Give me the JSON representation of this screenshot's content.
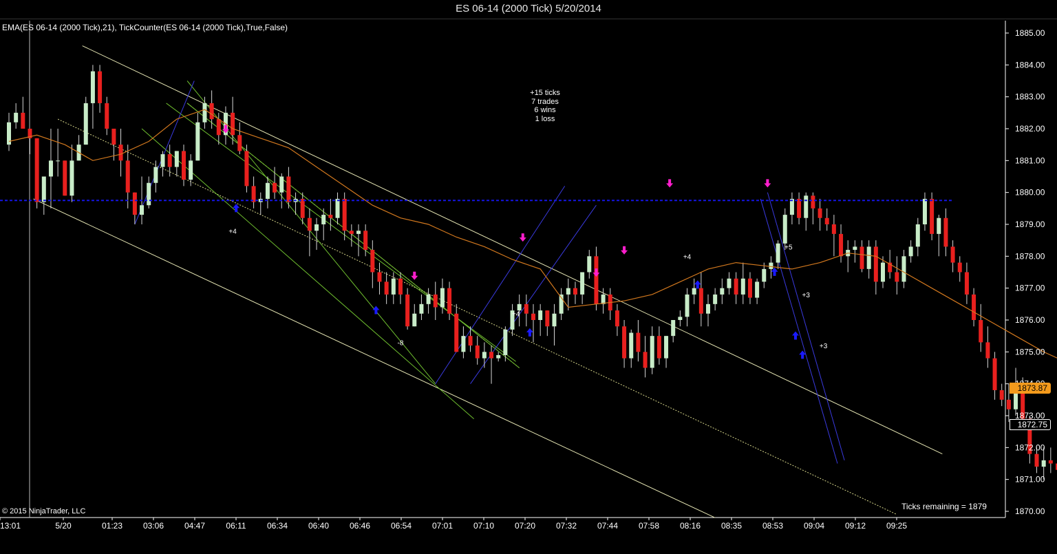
{
  "window": {
    "title": "ES 06-14 (2000 Tick)  5/20/2014"
  },
  "indicator_label": "EMA(ES 06-14 (2000 Tick),21),  TickCounter(ES 06-14 (2000 Tick),True,False)",
  "copyright": "© 2015 NinjaTrader, LLC",
  "ticks_remaining": "Ticks remaining = 1879",
  "stats": [
    "+15 ticks",
    "7 trades",
    "6 wins",
    "1 loss"
  ],
  "price_tags": {
    "ema": "1873.87",
    "last": "1872.75"
  },
  "colors": {
    "up_candle": "#c8ecc8",
    "down_candle": "#e8201e",
    "wick": "#d8d8d8",
    "ema": "#d2781e",
    "support": "#1414e6",
    "channel": "#e6e6b4",
    "fan_green": "#6fbf2f",
    "fan_blue": "#3a3ae0",
    "buy_arrow": "#1a1aff",
    "sell_arrow": "#ff1ecd",
    "axis_text": "#ffffff"
  },
  "chart_data": {
    "type": "candlestick",
    "y_axis": {
      "min": 1870,
      "max": 1885,
      "ticks": [
        "1885.00",
        "1884.00",
        "1883.00",
        "1882.00",
        "1881.00",
        "1880.00",
        "1879.00",
        "1878.00",
        "1877.00",
        "1876.00",
        "1875.00",
        "1874.00",
        "1873.00",
        "1872.00",
        "1871.00",
        "1870.00"
      ]
    },
    "x_labels": [
      "13:01",
      "5/20",
      "01:23",
      "03:06",
      "04:47",
      "06:11",
      "06:34",
      "06:40",
      "06:46",
      "06:54",
      "07:01",
      "07:10",
      "07:20",
      "07:32",
      "07:44",
      "07:58",
      "08:16",
      "08:35",
      "08:53",
      "09:04",
      "09:12",
      "09:25"
    ],
    "candles": [
      [
        1881.5,
        1882.5,
        1881.3,
        1882.2
      ],
      [
        1882.2,
        1882.8,
        1882.0,
        1882.5
      ],
      [
        1882.5,
        1883.0,
        1882.0,
        1882.0
      ],
      [
        1882.0,
        1882.0,
        1881.2,
        1881.7
      ],
      [
        1881.7,
        1881.7,
        1879.5,
        1879.7
      ],
      [
        1879.7,
        1880.5,
        1879.3,
        1880.5
      ],
      [
        1880.5,
        1882.0,
        1879.5,
        1881.0
      ],
      [
        1881.0,
        1882.0,
        1880.5,
        1881.0
      ],
      [
        1881.0,
        1881.0,
        1879.9,
        1879.9
      ],
      [
        1879.9,
        1881.5,
        1879.7,
        1881.0
      ],
      [
        1881.0,
        1881.8,
        1881.0,
        1881.5
      ],
      [
        1881.5,
        1883.0,
        1881.5,
        1882.8
      ],
      [
        1882.8,
        1884.0,
        1882.0,
        1883.8
      ],
      [
        1883.8,
        1884.0,
        1882.5,
        1882.8
      ],
      [
        1882.8,
        1883.0,
        1881.8,
        1882.0
      ],
      [
        1882.0,
        1882.0,
        1881.0,
        1881.5
      ],
      [
        1881.5,
        1882.0,
        1880.5,
        1881.0
      ],
      [
        1881.0,
        1881.5,
        1879.5,
        1880.0
      ],
      [
        1880.0,
        1880.0,
        1879.0,
        1879.3
      ],
      [
        1879.3,
        1880.5,
        1879.0,
        1879.6
      ],
      [
        1879.6,
        1880.5,
        1879.5,
        1880.3
      ],
      [
        1880.3,
        1881.0,
        1880.0,
        1880.8
      ],
      [
        1880.8,
        1881.3,
        1880.5,
        1881.2
      ],
      [
        1881.2,
        1881.5,
        1880.5,
        1880.8
      ],
      [
        1880.8,
        1881.3,
        1880.5,
        1881.3
      ],
      [
        1881.3,
        1881.5,
        1880.2,
        1880.4
      ],
      [
        1880.4,
        1881.2,
        1880.2,
        1881.0
      ],
      [
        1881.0,
        1882.5,
        1881.0,
        1882.2
      ],
      [
        1882.2,
        1883.0,
        1882.0,
        1882.8
      ],
      [
        1882.8,
        1883.2,
        1882.0,
        1882.3
      ],
      [
        1882.3,
        1882.5,
        1881.5,
        1881.8
      ],
      [
        1881.8,
        1882.7,
        1881.5,
        1882.5
      ],
      [
        1882.5,
        1883.0,
        1881.5,
        1881.8
      ],
      [
        1881.8,
        1882.2,
        1881.2,
        1881.3
      ],
      [
        1881.3,
        1881.5,
        1880.0,
        1880.2
      ],
      [
        1880.2,
        1880.5,
        1879.5,
        1879.7
      ],
      [
        1879.7,
        1880.0,
        1879.3,
        1879.8
      ],
      [
        1879.8,
        1880.5,
        1879.5,
        1880.3
      ],
      [
        1880.3,
        1880.8,
        1879.8,
        1880.0
      ],
      [
        1880.0,
        1880.6,
        1879.5,
        1880.5
      ],
      [
        1880.5,
        1880.8,
        1879.5,
        1879.7
      ],
      [
        1879.7,
        1880.0,
        1879.3,
        1879.8
      ],
      [
        1879.8,
        1880.0,
        1879.0,
        1879.2
      ],
      [
        1879.2,
        1879.5,
        1878.0,
        1878.8
      ],
      [
        1878.8,
        1879.2,
        1878.2,
        1879.0
      ],
      [
        1879.0,
        1879.5,
        1878.5,
        1879.3
      ],
      [
        1879.3,
        1879.8,
        1878.8,
        1879.2
      ],
      [
        1879.2,
        1880.0,
        1879.0,
        1879.8
      ],
      [
        1879.8,
        1880.0,
        1878.5,
        1878.8
      ],
      [
        1878.8,
        1879.0,
        1878.3,
        1878.7
      ],
      [
        1878.7,
        1879.0,
        1878.0,
        1878.8
      ],
      [
        1878.8,
        1879.0,
        1878.0,
        1878.2
      ],
      [
        1878.2,
        1878.5,
        1877.0,
        1877.5
      ],
      [
        1877.5,
        1877.8,
        1876.8,
        1877.2
      ],
      [
        1877.2,
        1877.5,
        1876.5,
        1876.8
      ],
      [
        1876.8,
        1877.5,
        1876.5,
        1877.3
      ],
      [
        1877.3,
        1877.5,
        1876.5,
        1876.8
      ],
      [
        1876.8,
        1877.0,
        1875.7,
        1875.8
      ],
      [
        1875.8,
        1876.5,
        1875.8,
        1876.2
      ],
      [
        1876.2,
        1876.8,
        1876.0,
        1876.5
      ],
      [
        1876.5,
        1877.0,
        1876.2,
        1876.8
      ],
      [
        1876.8,
        1877.2,
        1876.0,
        1876.4
      ],
      [
        1876.4,
        1877.3,
        1876.2,
        1877.0
      ],
      [
        1877.0,
        1877.2,
        1876.0,
        1876.2
      ],
      [
        1876.2,
        1876.5,
        1875.0,
        1875.0
      ],
      [
        1875.0,
        1875.8,
        1874.8,
        1875.5
      ],
      [
        1875.5,
        1875.8,
        1875.0,
        1875.2
      ],
      [
        1875.2,
        1875.5,
        1874.6,
        1874.8
      ],
      [
        1874.8,
        1875.3,
        1874.5,
        1875.0
      ],
      [
        1875.0,
        1875.2,
        1874.0,
        1874.8
      ],
      [
        1874.8,
        1875.0,
        1874.7,
        1874.9
      ],
      [
        1874.9,
        1875.8,
        1874.7,
        1875.7
      ],
      [
        1875.7,
        1876.5,
        1875.5,
        1876.3
      ],
      [
        1876.3,
        1876.8,
        1875.8,
        1876.5
      ],
      [
        1876.5,
        1876.8,
        1875.8,
        1876.2
      ],
      [
        1876.2,
        1876.5,
        1875.3,
        1876.0
      ],
      [
        1876.0,
        1876.5,
        1875.5,
        1876.3
      ],
      [
        1876.3,
        1876.3,
        1875.5,
        1875.8
      ],
      [
        1875.8,
        1876.5,
        1875.2,
        1876.2
      ],
      [
        1876.2,
        1877.0,
        1876.0,
        1876.8
      ],
      [
        1876.8,
        1877.3,
        1876.3,
        1877.0
      ],
      [
        1877.0,
        1877.2,
        1876.5,
        1876.8
      ],
      [
        1876.8,
        1877.5,
        1876.5,
        1877.5
      ],
      [
        1877.5,
        1878.2,
        1877.3,
        1878.0
      ],
      [
        1878.0,
        1878.3,
        1876.3,
        1876.5
      ],
      [
        1876.5,
        1877.0,
        1876.2,
        1876.8
      ],
      [
        1876.8,
        1877.0,
        1876.0,
        1876.3
      ],
      [
        1876.3,
        1876.5,
        1875.5,
        1875.8
      ],
      [
        1875.8,
        1876.0,
        1874.5,
        1874.8
      ],
      [
        1874.8,
        1875.7,
        1874.5,
        1875.6
      ],
      [
        1875.6,
        1876.0,
        1874.7,
        1875.0
      ],
      [
        1875.0,
        1875.5,
        1874.2,
        1874.5
      ],
      [
        1874.5,
        1875.8,
        1874.3,
        1875.5
      ],
      [
        1875.5,
        1875.8,
        1874.6,
        1874.8
      ],
      [
        1874.8,
        1875.5,
        1874.5,
        1875.5
      ],
      [
        1875.5,
        1876.0,
        1875.3,
        1876.0
      ],
      [
        1876.0,
        1876.3,
        1875.8,
        1876.1
      ],
      [
        1876.1,
        1877.0,
        1875.8,
        1876.8
      ],
      [
        1876.8,
        1877.3,
        1876.5,
        1877.0
      ],
      [
        1877.0,
        1877.5,
        1875.8,
        1876.2
      ],
      [
        1876.2,
        1876.8,
        1875.8,
        1876.5
      ],
      [
        1876.5,
        1877.0,
        1876.3,
        1876.8
      ],
      [
        1876.8,
        1877.3,
        1876.5,
        1877.0
      ],
      [
        1877.0,
        1877.5,
        1876.8,
        1877.3
      ],
      [
        1877.3,
        1877.5,
        1876.5,
        1876.8
      ],
      [
        1876.8,
        1877.8,
        1876.5,
        1877.3
      ],
      [
        1877.3,
        1877.5,
        1876.5,
        1876.7
      ],
      [
        1876.7,
        1877.3,
        1876.5,
        1877.2
      ],
      [
        1877.2,
        1877.8,
        1877.0,
        1877.6
      ],
      [
        1877.6,
        1878.0,
        1877.3,
        1877.8
      ],
      [
        1877.8,
        1878.5,
        1877.6,
        1878.4
      ],
      [
        1878.4,
        1879.5,
        1878.2,
        1879.3
      ],
      [
        1879.3,
        1880.0,
        1879.0,
        1879.8
      ],
      [
        1879.8,
        1880.0,
        1879.0,
        1879.2
      ],
      [
        1879.2,
        1880.0,
        1878.8,
        1879.9
      ],
      [
        1879.9,
        1880.0,
        1879.0,
        1879.5
      ],
      [
        1879.5,
        1879.8,
        1878.8,
        1879.2
      ],
      [
        1879.2,
        1879.5,
        1878.8,
        1879.0
      ],
      [
        1879.0,
        1879.3,
        1878.0,
        1878.7
      ],
      [
        1878.7,
        1879.0,
        1877.8,
        1878.0
      ],
      [
        1878.0,
        1878.5,
        1877.5,
        1878.2
      ],
      [
        1878.2,
        1878.5,
        1877.8,
        1878.3
      ],
      [
        1878.3,
        1878.5,
        1877.5,
        1877.6
      ],
      [
        1877.6,
        1878.5,
        1877.3,
        1878.3
      ],
      [
        1878.3,
        1878.5,
        1876.8,
        1877.2
      ],
      [
        1877.2,
        1878.0,
        1877.0,
        1877.8
      ],
      [
        1877.8,
        1878.2,
        1877.3,
        1877.5
      ],
      [
        1877.5,
        1878.0,
        1876.8,
        1877.2
      ],
      [
        1877.2,
        1878.2,
        1877.0,
        1878.0
      ],
      [
        1878.0,
        1878.5,
        1877.8,
        1878.3
      ],
      [
        1878.3,
        1879.2,
        1878.0,
        1879.0
      ],
      [
        1879.0,
        1880.0,
        1878.8,
        1879.8
      ],
      [
        1879.8,
        1880.0,
        1878.5,
        1878.7
      ],
      [
        1878.7,
        1879.3,
        1878.0,
        1879.2
      ],
      [
        1879.2,
        1879.5,
        1878.0,
        1878.3
      ],
      [
        1878.3,
        1878.5,
        1877.5,
        1877.8
      ],
      [
        1877.8,
        1878.0,
        1877.2,
        1877.5
      ],
      [
        1877.5,
        1877.8,
        1876.5,
        1876.8
      ],
      [
        1876.8,
        1877.0,
        1875.8,
        1876.0
      ],
      [
        1876.0,
        1876.5,
        1875.0,
        1875.3
      ],
      [
        1875.3,
        1875.8,
        1874.5,
        1874.8
      ],
      [
        1874.8,
        1875.0,
        1873.5,
        1873.8
      ],
      [
        1873.8,
        1874.0,
        1873.3,
        1873.5
      ],
      [
        1873.5,
        1874.0,
        1872.8,
        1873.2
      ],
      [
        1873.2,
        1874.5,
        1873.0,
        1874.0
      ],
      [
        1874.0,
        1874.2,
        1872.8,
        1872.9
      ],
      [
        1872.9,
        1873.0,
        1871.5,
        1871.8
      ],
      [
        1871.8,
        1872.0,
        1871.2,
        1871.4
      ],
      [
        1871.4,
        1872.0,
        1871.0,
        1871.6
      ],
      [
        1871.6,
        1872.0,
        1871.2,
        1871.5
      ],
      [
        1871.5,
        1871.8,
        1871.0,
        1871.3
      ],
      [
        1871.3,
        1872.8,
        1871.0,
        1872.5
      ],
      [
        1872.5,
        1873.0,
        1872.3,
        1873.0
      ],
      [
        1873.0,
        1873.2,
        1872.5,
        1872.75
      ]
    ],
    "ema_anchors": [
      [
        1881.6,
        1881.8
      ],
      [
        1881.8,
        1881.0
      ],
      [
        1881.5,
        1881.7
      ],
      [
        1881.0,
        1880.6
      ],
      [
        1881.2,
        1880.4
      ],
      [
        1881.6,
        1880.0
      ],
      [
        1882.3,
        1879.6
      ],
      [
        1882.6,
        1879.2
      ],
      [
        1882.0,
        1878.6
      ],
      [
        1881.7,
        1878.0
      ],
      [
        1881.4,
        1877.6
      ],
      [
        1880.8,
        1877.2
      ],
      [
        1880.2,
        1876.9
      ],
      [
        1879.6,
        1876.6
      ],
      [
        1879.2,
        1876.4
      ],
      [
        1879.0,
        1876.2
      ],
      [
        1878.6,
        1876.1
      ],
      [
        1878.3,
        1876.1
      ],
      [
        1877.9,
        1876.2
      ],
      [
        1877.6,
        1876.3
      ],
      [
        1877.3,
        1876.4
      ],
      [
        1877.0,
        1876.5
      ],
      [
        1876.7,
        1876.6
      ],
      [
        1876.5,
        1876.8
      ],
      [
        1876.3,
        1877.2
      ],
      [
        1876.2,
        1877.6
      ],
      [
        1876.2,
        1877.8
      ],
      [
        1876.3,
        1877.7
      ],
      [
        1876.4,
        1877.6
      ],
      [
        1876.6,
        1877.8
      ],
      [
        1876.8,
        1878.1
      ],
      [
        1877.0,
        1878.0
      ],
      [
        1877.3,
        1877.5
      ],
      [
        1877.6,
        1877.0
      ],
      [
        1877.8,
        1876.5
      ],
      [
        1877.8,
        1876.0
      ],
      [
        1877.7,
        1875.5
      ],
      [
        1877.6,
        1875.0
      ],
      [
        1877.7,
        1874.6
      ],
      [
        1877.9,
        1874.2
      ],
      [
        1878.0,
        1874.0
      ],
      [
        1877.8,
        1873.87
      ]
    ],
    "support_level": 1879.75,
    "trade_labels": [
      "+4",
      "-8",
      "+4",
      "+4",
      "+5",
      "+3",
      "+3"
    ]
  }
}
